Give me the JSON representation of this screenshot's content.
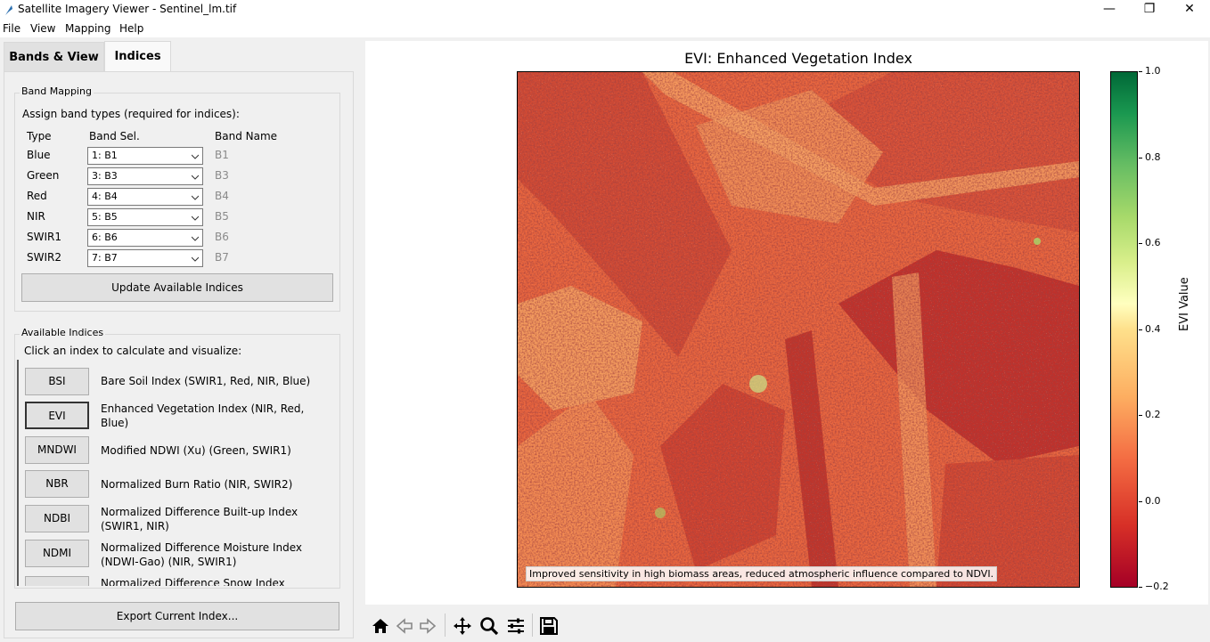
{
  "window": {
    "title": "Satellite Imagery Viewer - Sentinel_lm.tif",
    "controls": [
      "minimize",
      "maximize",
      "close"
    ]
  },
  "menu": [
    "File",
    "View",
    "Mapping",
    "Help"
  ],
  "tabs": [
    {
      "label": "Bands & View",
      "active": false
    },
    {
      "label": "Indices",
      "active": true
    }
  ],
  "band_mapping": {
    "title": "Band Mapping",
    "instruction": "Assign band types (required for indices):",
    "headers": {
      "type": "Type",
      "band_sel": "Band Sel.",
      "band_name": "Band Name"
    },
    "rows": [
      {
        "type": "Blue",
        "selection": "1: B1",
        "name": "B1"
      },
      {
        "type": "Green",
        "selection": "3: B3",
        "name": "B3"
      },
      {
        "type": "Red",
        "selection": "4: B4",
        "name": "B4"
      },
      {
        "type": "NIR",
        "selection": "5: B5",
        "name": "B5"
      },
      {
        "type": "SWIR1",
        "selection": "6: B6",
        "name": "B6"
      },
      {
        "type": "SWIR2",
        "selection": "7: B7",
        "name": "B7"
      }
    ],
    "update_button": "Update Available Indices"
  },
  "available_indices": {
    "title": "Available Indices",
    "instruction": "Click an index to calculate and visualize:",
    "items": [
      {
        "code": "BSI",
        "description": "Bare Soil Index (SWIR1, Red, NIR, Blue)"
      },
      {
        "code": "EVI",
        "description": "Enhanced Vegetation Index (NIR, Red, Blue)",
        "selected": true
      },
      {
        "code": "MNDWI",
        "description": "Modified NDWI (Xu) (Green, SWIR1)"
      },
      {
        "code": "NBR",
        "description": "Normalized Burn Ratio (NIR, SWIR2)"
      },
      {
        "code": "NDBI",
        "description": "Normalized Difference Built-up Index (SWIR1, NIR)"
      },
      {
        "code": "NDMI",
        "description": "Normalized Difference Moisture Index (NDWI-Gao) (NIR, SWIR1)"
      },
      {
        "code": "",
        "description": "Normalized Difference Snow Index (Green"
      }
    ]
  },
  "export_button": "Export Current Index...",
  "plot": {
    "title": "EVI: Enhanced Vegetation Index",
    "info": "Improved sensitivity in high biomass areas, reduced atmospheric influence compared to NDVI.",
    "colorbar": {
      "label": "EVI Value",
      "min": -0.2,
      "max": 1.0,
      "ticks": [
        "1.0",
        "0.8",
        "0.6",
        "0.4",
        "0.2",
        "0.0",
        "−0.2"
      ],
      "colormap": [
        "#a50026",
        "#d73027",
        "#f46d43",
        "#fdae61",
        "#fee08b",
        "#ffffbf",
        "#d9ef8b",
        "#a6d96a",
        "#66bd63",
        "#1a9850",
        "#006837"
      ]
    }
  },
  "toolbar": [
    "home-icon",
    "back-icon",
    "forward-icon",
    "pan-icon",
    "zoom-icon",
    "configure-icon",
    "save-icon"
  ]
}
